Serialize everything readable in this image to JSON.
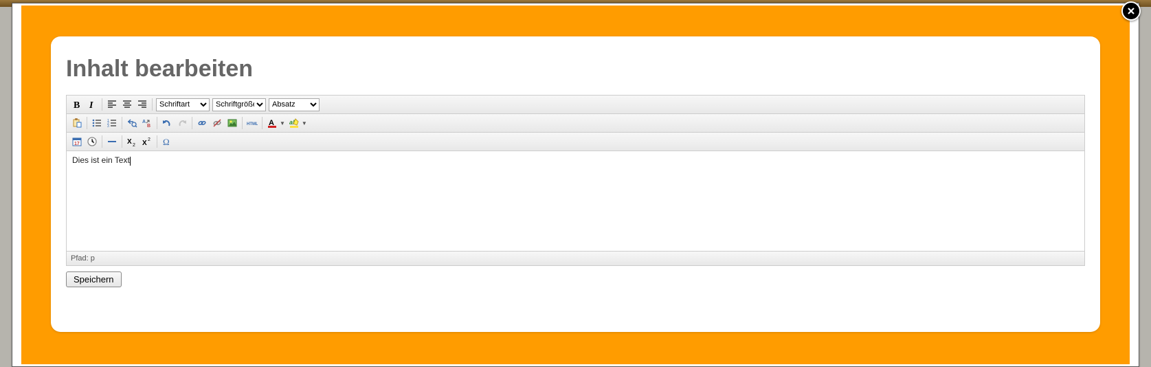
{
  "heading": "Inhalt bearbeiten",
  "toolbar": {
    "font_family_selected": "Schriftart",
    "font_size_selected": "Schriftgröße",
    "block_format_selected": "Absatz"
  },
  "content_text": "Dies ist ein Text",
  "status_path": "Pfad: p",
  "save_label": "Speichern"
}
